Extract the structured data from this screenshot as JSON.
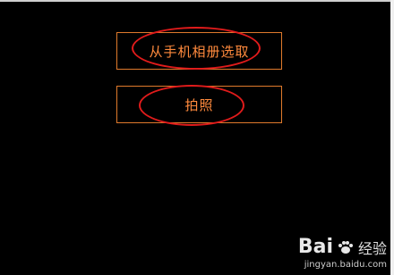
{
  "options": {
    "album_label": "从手机相册选取",
    "camera_label": "拍照"
  },
  "watermark": {
    "brand_left": "Bai",
    "brand_right": "经验",
    "url": "jingyan.baidu.com"
  },
  "colors": {
    "background": "#000000",
    "button_border": "#e07a2c",
    "button_text": "#ff8a3d",
    "annotation": "#e01b1b"
  }
}
